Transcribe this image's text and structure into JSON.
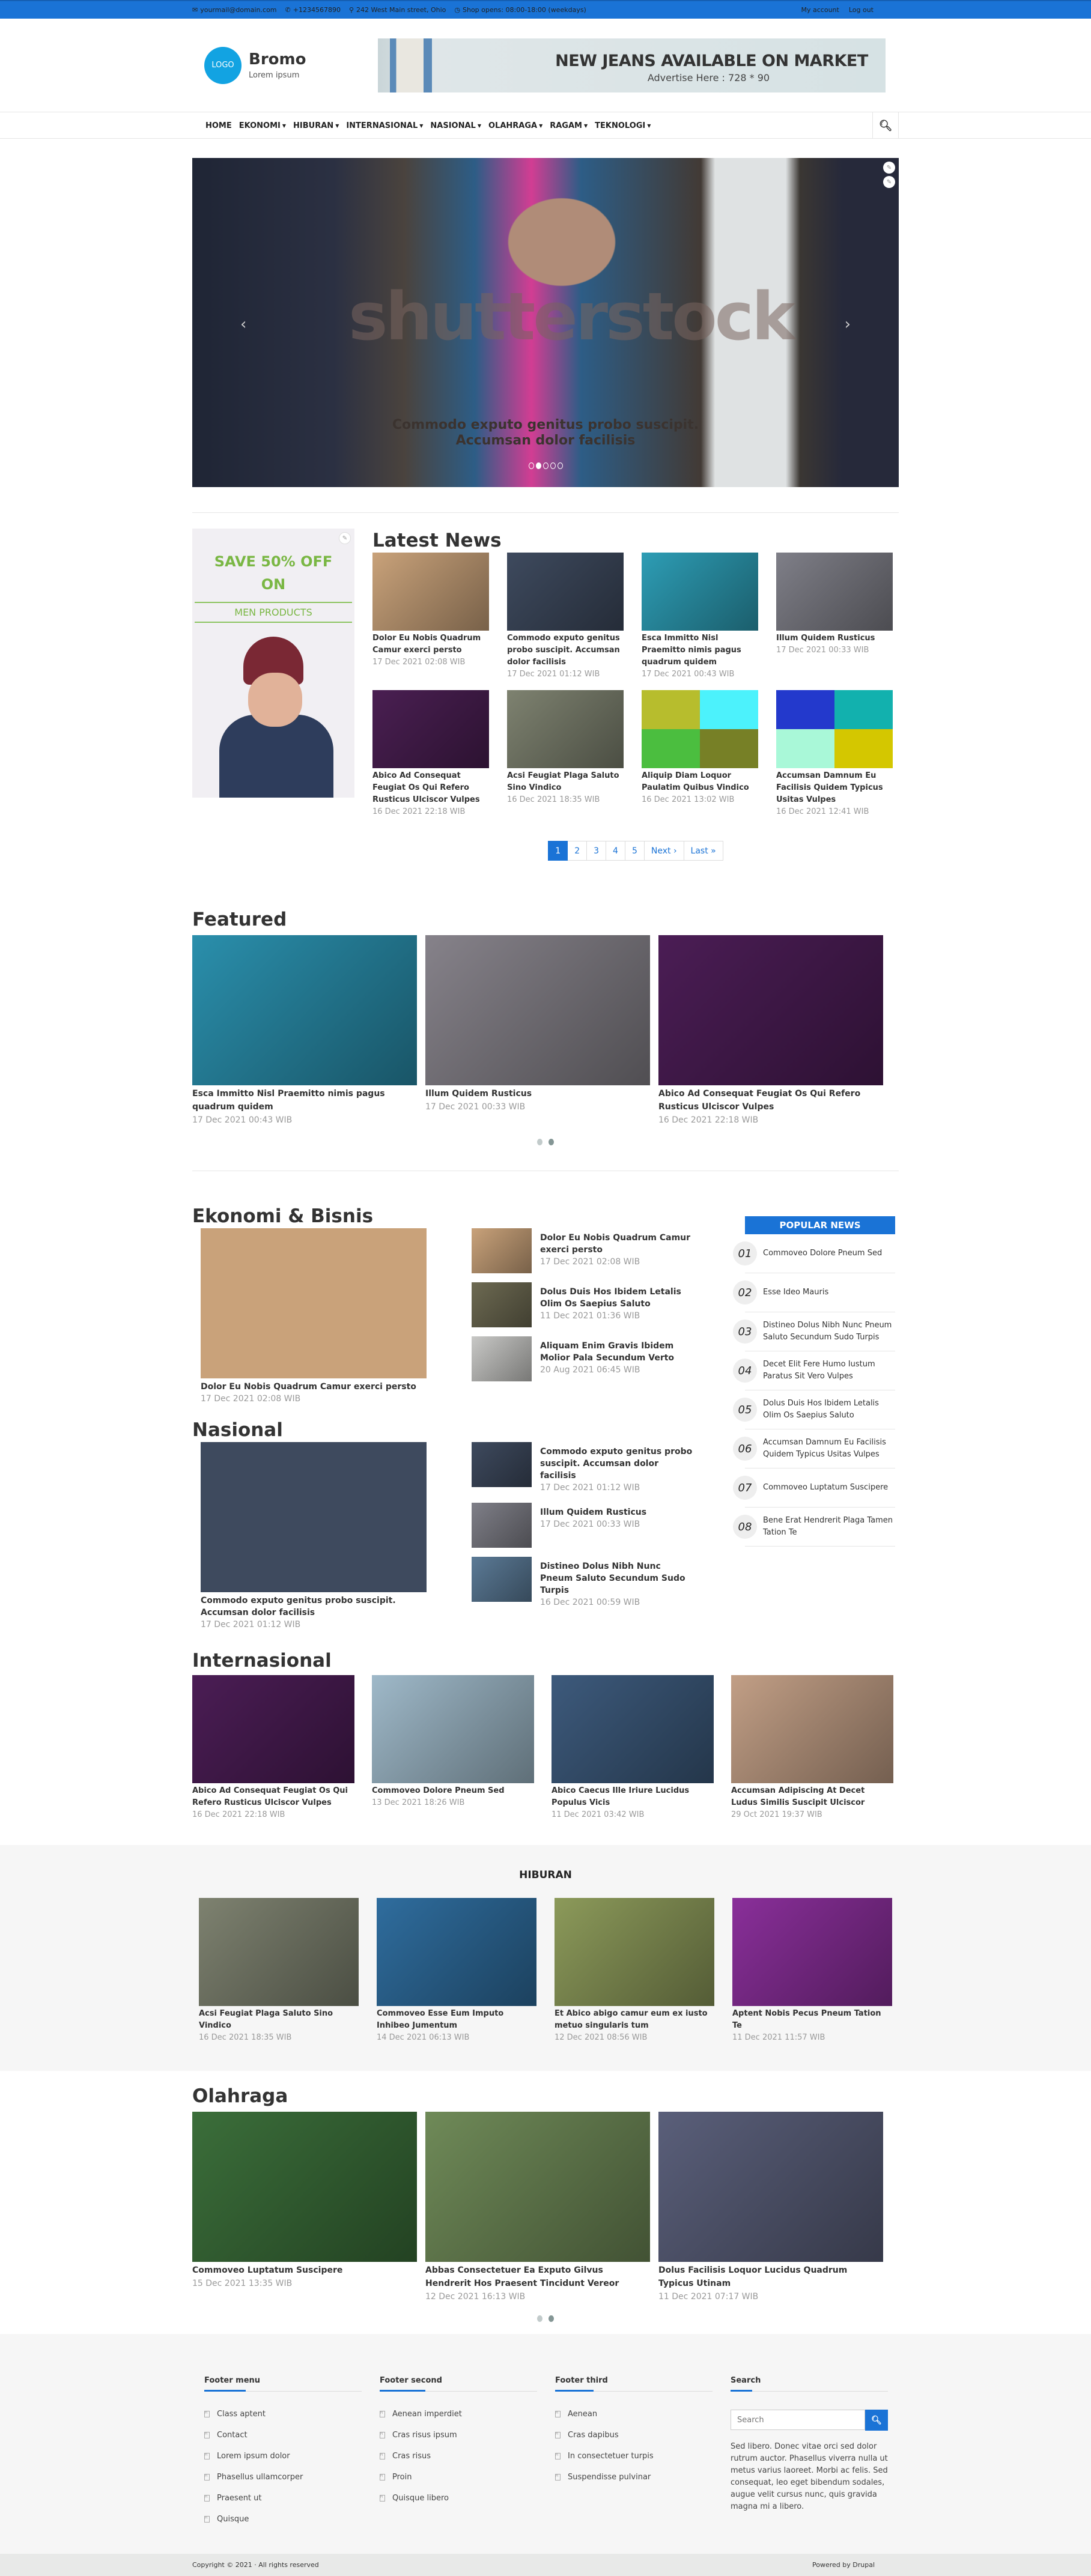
{
  "topbar": {
    "email": "yourmail@domain.com",
    "phone": "+1234567890",
    "address": "242 West Main street, Ohio",
    "hours": "Shop opens: 08:00-18:00 (weekdays)",
    "my_account": "My account",
    "logout": "Log out"
  },
  "header": {
    "logo_text": "LOGO",
    "site_name": "Bromo",
    "slogan": "Lorem ipsum",
    "ad_title": "NEW JEANS AVAILABLE ON MARKET",
    "ad_sub": "Advertise Here : 728 * 90"
  },
  "nav": {
    "items": [
      {
        "label": "HOME",
        "dropdown": false
      },
      {
        "label": "EKONOMI",
        "dropdown": true
      },
      {
        "label": "HIBURAN",
        "dropdown": true
      },
      {
        "label": "INTERNASIONAL",
        "dropdown": true
      },
      {
        "label": "NASIONAL",
        "dropdown": true
      },
      {
        "label": "OLAHRAGA",
        "dropdown": true
      },
      {
        "label": "RAGAM",
        "dropdown": true
      },
      {
        "label": "TEKNOLOGI",
        "dropdown": true
      }
    ]
  },
  "slider": {
    "watermark": "shutterstock",
    "caption": "Commodo exputo genitus probo suscipit. Accumsan dolor facilisis",
    "slide_count": 5,
    "active_slide": 2,
    "prev": "‹",
    "next": "›"
  },
  "promo": {
    "line1": "SAVE 50% OFF",
    "line2": "ON",
    "line3": "MEN PRODUCTS"
  },
  "latest": {
    "title": "Latest News",
    "items": [
      {
        "title": "Dolor Eu Nobis Quadrum Camur exerci persto",
        "date": "17 Dec 2021 02:08 WIB",
        "color": "#c9a27a"
      },
      {
        "title": "Commodo exputo genitus probo suscipit. Accumsan dolor facilisis",
        "date": "17 Dec 2021 01:12 WIB",
        "color": "#3e4a5e"
      },
      {
        "title": "Esca Immitto Nisl Praemitto nimis pagus quadrum quidem",
        "date": "17 Dec 2021 00:43 WIB",
        "color": "#2d9db5"
      },
      {
        "title": "Illum Quidem Rusticus",
        "date": "17 Dec 2021 00:33 WIB",
        "color": "#7f7f88"
      },
      {
        "title": "Abico Ad Consequat Feugiat Os Qui Refero Rusticus Ulciscor Vulpes",
        "date": "16 Dec 2021 22:18 WIB",
        "color": "#4a1f52"
      },
      {
        "title": "Acsi Feugiat Plaga Saluto Sino Vindico",
        "date": "16 Dec 2021 18:35 WIB",
        "color": "#7e8270"
      },
      {
        "title": "Aliquip Diam Loquor Paulatim Quibus Vindico",
        "date": "16 Dec 2021 13:02 WIB",
        "quad": [
          "#b7bd2d",
          "#4cf2fc",
          "#4bbe3f",
          "#778026"
        ]
      },
      {
        "title": "Accumsan Damnum Eu Facilisis Quidem Typicus Usitas Vulpes",
        "date": "16 Dec 2021 12:41 WIB",
        "quad": [
          "#2339cc",
          "#12b1ae",
          "#a9f8d8",
          "#d4c700"
        ]
      }
    ],
    "pager": [
      "1",
      "2",
      "3",
      "4",
      "5",
      "Next ›",
      "Last »"
    ],
    "current_page": "1"
  },
  "featured": {
    "title": "Featured",
    "items": [
      {
        "title": "Esca Immitto Nisl Praemitto nimis pagus quadrum quidem",
        "date": "17 Dec 2021 00:43 WIB",
        "color": "#2a8fac"
      },
      {
        "title": "Illum Quidem Rusticus",
        "date": "17 Dec 2021 00:33 WIB",
        "color": "#86828a"
      },
      {
        "title": "Abico Ad Consequat Feugiat Os Qui Refero Rusticus Ulciscor Vulpes",
        "date": "16 Dec 2021 22:18 WIB",
        "color": "#4b1d55"
      }
    ],
    "dots": 2,
    "active_dot": 2
  },
  "ekonomi": {
    "title": "Ekonomi & Bisnis",
    "main": {
      "title": "Dolor Eu Nobis Quadrum Camur exerci persto",
      "date": "17 Dec 2021 02:08 WIB",
      "color": "#c9a27a"
    },
    "list": [
      {
        "title": "Dolor Eu Nobis Quadrum Camur exerci persto",
        "date": "17 Dec 2021 02:08 WIB",
        "color": "#c9a27a"
      },
      {
        "title": "Dolus Duis Hos Ibidem Letalis Olim Os Saepius Saluto",
        "date": "11 Dec 2021 01:36 WIB",
        "color": "#6d6a52"
      },
      {
        "title": "Aliquam Enim Gravis Ibidem Molior Pala Secundum Verto",
        "date": "20 Aug 2021 06:45 WIB",
        "color": "#c8c8c6"
      }
    ]
  },
  "nasional": {
    "title": "Nasional",
    "main": {
      "title": "Commodo exputo genitus probo suscipit. Accumsan dolor facilisis",
      "date": "17 Dec 2021 01:12 WIB",
      "color": "#3e4a5e"
    },
    "list": [
      {
        "title": "Commodo exputo genitus probo suscipit. Accumsan dolor facilisis",
        "date": "17 Dec 2021 01:12 WIB",
        "color": "#3e4a5e"
      },
      {
        "title": "Illum Quidem Rusticus",
        "date": "17 Dec 2021 00:33 WIB",
        "color": "#7f7f88"
      },
      {
        "title": "Distineo Dolus Nibh Nunc Pneum Saluto Secundum Sudo Turpis",
        "date": "16 Dec 2021 00:59 WIB",
        "color": "#5b7a96"
      }
    ]
  },
  "popular": {
    "title": "POPULAR NEWS",
    "items": [
      {
        "num": "01",
        "title": "Commoveo Dolore Pneum Sed"
      },
      {
        "num": "02",
        "title": "Esse Ideo Mauris"
      },
      {
        "num": "03",
        "title": "Distineo Dolus Nibh Nunc Pneum Saluto Secundum Sudo Turpis"
      },
      {
        "num": "04",
        "title": "Decet Elit Fere Humo Iustum Paratus Sit Vero Vulpes"
      },
      {
        "num": "05",
        "title": "Dolus Duis Hos Ibidem Letalis Olim Os Saepius Saluto"
      },
      {
        "num": "06",
        "title": "Accumsan Damnum Eu Facilisis Quidem Typicus Usitas Vulpes"
      },
      {
        "num": "07",
        "title": "Commoveo Luptatum Suscipere"
      },
      {
        "num": "08",
        "title": "Bene Erat Hendrerit Plaga Tamen Tation Te"
      }
    ]
  },
  "internasional": {
    "title": "Internasional",
    "items": [
      {
        "title": "Abico Ad Consequat Feugiat Os Qui Refero Rusticus Ulciscor Vulpes",
        "date": "16 Dec 2021 22:18 WIB",
        "color": "#4b1d55"
      },
      {
        "title": "Commoveo Dolore Pneum Sed",
        "date": "13 Dec 2021 18:26 WIB",
        "color": "#9fb9c9"
      },
      {
        "title": "Abico Caecus Ille Iriure Lucidus Populus Vicis",
        "date": "11 Dec 2021 03:42 WIB",
        "color": "#3d5a7c"
      },
      {
        "title": "Accumsan Adipiscing At Decet Ludus Similis Suscipit Ulciscor",
        "date": "29 Oct 2021 19:37 WIB",
        "color": "#c29f86"
      }
    ]
  },
  "hiburan": {
    "title": "HIBURAN",
    "items": [
      {
        "title": "Acsi Feugiat Plaga Saluto Sino Vindico",
        "date": "16 Dec 2021 18:35 WIB",
        "color": "#7e8270"
      },
      {
        "title": "Commoveo Esse Eum Imputo Inhibeo Jumentum",
        "date": "14 Dec 2021 06:13 WIB",
        "color": "#2f6d9e"
      },
      {
        "title": "Et Abico abigo camur eum ex iusto metuo singularis tum",
        "date": "12 Dec 2021 08:56 WIB",
        "color": "#8c9a5a"
      },
      {
        "title": "Aptent Nobis Pecus Pneum Tation Te",
        "date": "11 Dec 2021 11:57 WIB",
        "color": "#8a2f9a"
      }
    ]
  },
  "olahraga": {
    "title": "Olahraga",
    "items": [
      {
        "title": "Commoveo Luptatum Suscipere",
        "date": "15 Dec 2021 13:35 WIB",
        "color": "#3b6e3a"
      },
      {
        "title": "Abbas Consectetuer Ea Exputo Gilvus Hendrerit Hos Praesent Tincidunt Vereor",
        "date": "12 Dec 2021 16:13 WIB",
        "color": "#6f8a58"
      },
      {
        "title": "Dolus Facilisis Loquor Lucidus Quadrum Typicus Utinam",
        "date": "11 Dec 2021 07:17 WIB",
        "color": "#5a5f7a"
      }
    ],
    "dots": 2,
    "active_dot": 2
  },
  "footer": {
    "col1": {
      "title": "Footer menu",
      "links": [
        "Class aptent",
        "Contact",
        "Lorem ipsum dolor",
        "Phasellus ullamcorper",
        "Praesent ut",
        "Quisque"
      ]
    },
    "col2": {
      "title": "Footer second",
      "links": [
        "Aenean imperdiet",
        "Cras risus ipsum",
        "Cras risus",
        "Proin",
        "Quisque libero"
      ]
    },
    "col3": {
      "title": "Footer third",
      "links": [
        "Aenean",
        "Cras dapibus",
        "In consectetuer turpis",
        "Suspendisse pulvinar"
      ]
    },
    "col4": {
      "title": "Search",
      "placeholder": "Search",
      "text": "Sed libero. Donec vitae orci sed dolor rutrum auctor. Phasellus viverra nulla ut metus varius laoreet. Morbi ac felis. Sed consequat, leo eget bibendum sodales, augue velit cursus nunc, quis gravida magna mi a libero."
    },
    "copyright": "Copyright © 2021 · All rights reserved",
    "powered": "Powered by Drupal"
  },
  "colors": {
    "accent": "#1a73d6",
    "promo_green": "#7ab744",
    "meta_gray": "#999999"
  }
}
